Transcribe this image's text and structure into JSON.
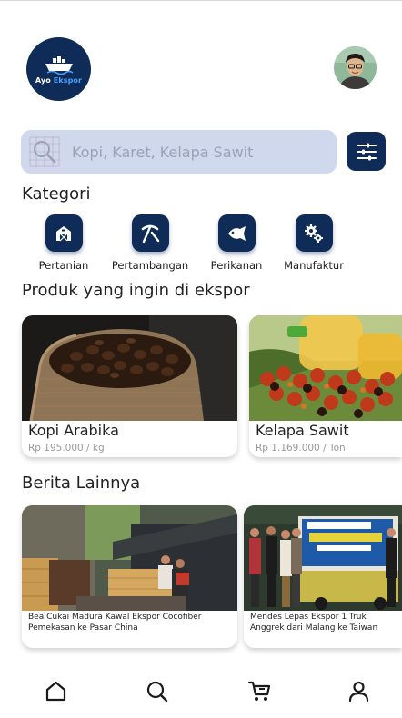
{
  "app": {
    "logo_text_1": "Ayo",
    "logo_text_2": "Ekspor"
  },
  "search": {
    "placeholder": "Kopi, Karet, Kelapa Sawit"
  },
  "categories": {
    "title": "Kategori",
    "items": [
      {
        "label": "Pertanian",
        "icon": "barn-icon"
      },
      {
        "label": "Pertambangan",
        "icon": "pickaxe-icon"
      },
      {
        "label": "Perikanan",
        "icon": "fish-icon"
      },
      {
        "label": "Manufaktur",
        "icon": "gears-icon"
      }
    ]
  },
  "products": {
    "title": "Produk yang ingin di ekspor",
    "items": [
      {
        "name": "Kopi Arabika",
        "price": "Rp 195.000 / kg"
      },
      {
        "name": "Kelapa Sawit",
        "price": "Rp 1.169.000 / Ton"
      }
    ]
  },
  "news": {
    "title": "Berita Lainnya",
    "items": [
      {
        "headline": "Bea Cukai Madura Kawal Ekspor Cocofiber Pemekasan ke Pasar China"
      },
      {
        "headline": "Mendes Lepas Ekspor 1 Truk Anggrek dari Malang ke Taiwan"
      }
    ]
  },
  "nav": {
    "items": [
      "home-icon",
      "search-icon",
      "cart-icon",
      "profile-icon"
    ]
  },
  "colors": {
    "primary": "#0f2b57",
    "search_bg": "#cfd8ec"
  }
}
